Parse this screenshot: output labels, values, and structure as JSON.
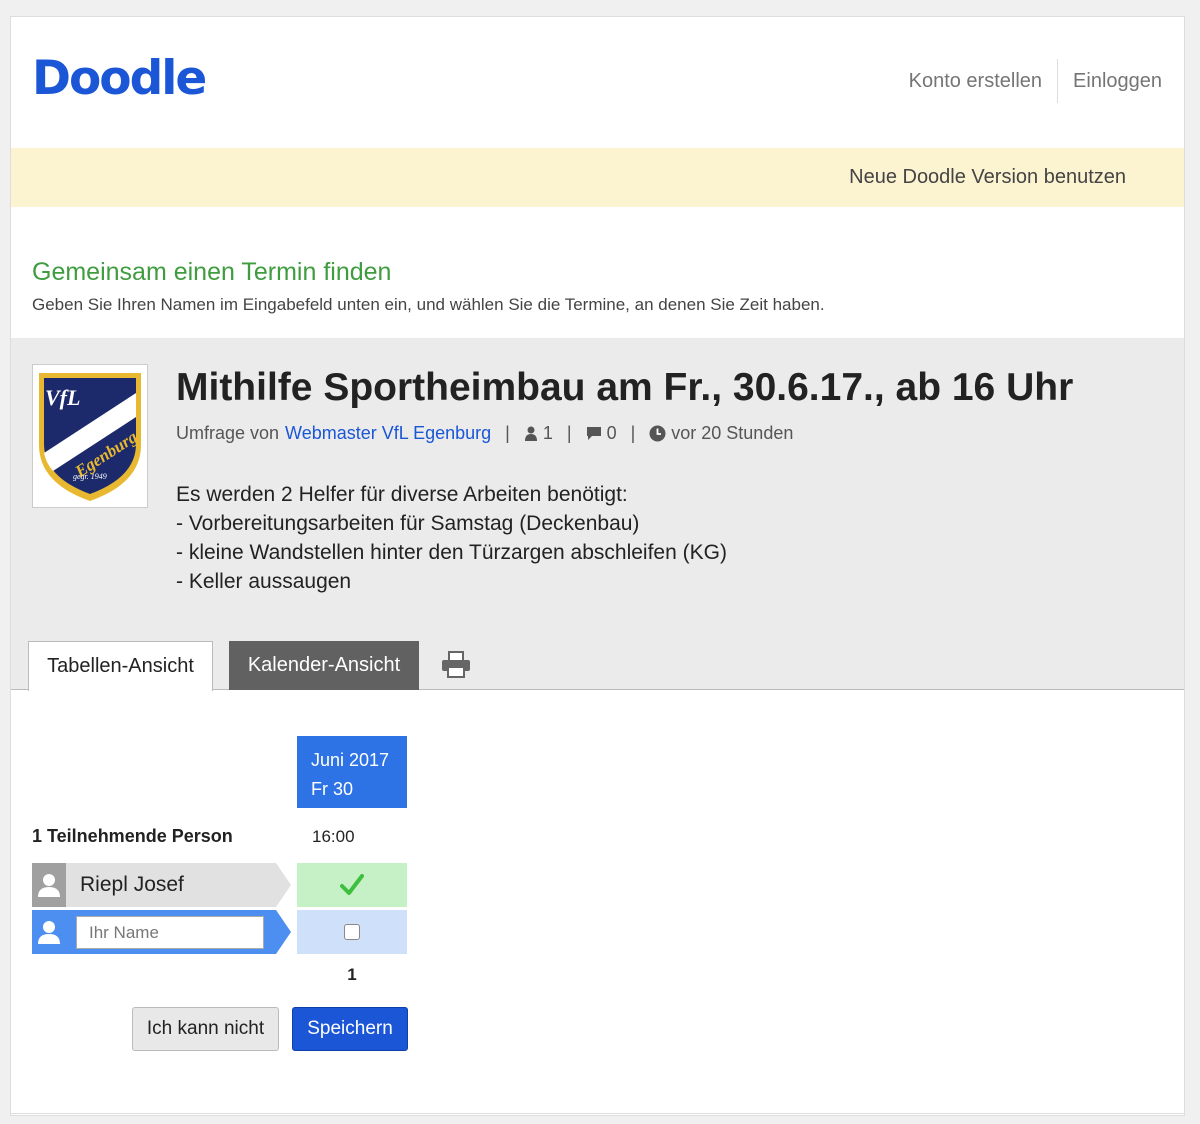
{
  "header": {
    "logo": "Doodle",
    "nav": {
      "signup": "Konto erstellen",
      "login": "Einloggen"
    }
  },
  "banner": {
    "link": "Neue Doodle Version benutzen"
  },
  "intro": {
    "title": "Gemeinsam einen Termin finden",
    "subtitle": "Geben Sie Ihren Namen im Eingabefeld unten ein, und wählen Sie die Termine, an denen Sie Zeit haben."
  },
  "poll": {
    "title": "Mithilfe Sportheimbau am Fr., 30.6.17., ab 16 Uhr",
    "author_prefix": "Umfrage von",
    "author": "Webmaster VfL Egenburg",
    "participants_count": "1",
    "comments_count": "0",
    "created": "vor 20 Stunden",
    "description": [
      "Es werden 2 Helfer für diverse Arbeiten benötigt:",
      "- Vorbereitungsarbeiten für Samstag (Deckenbau)",
      "- kleine Wandstellen hinter den Türzargen abschleifen (KG)",
      "- Keller aussaugen"
    ],
    "logo_text": {
      "line1": "VfL",
      "line2": "Egenburg",
      "line3": "gegr. 1949"
    }
  },
  "tabs": {
    "table": "Tabellen-Ansicht",
    "calendar": "Kalender-Ansicht"
  },
  "grid": {
    "month": "Juni 2017",
    "day": "Fr 30",
    "time": "16:00",
    "participants_label": "1 Teilnehmende Person",
    "rows": [
      {
        "name": "Riepl Josef",
        "vote": "yes"
      }
    ],
    "name_placeholder": "Ihr Name",
    "total": "1"
  },
  "buttons": {
    "cant": "Ich kann nicht",
    "save": "Speichern"
  },
  "colors": {
    "brand": "#1a56d6",
    "intro_green": "#3f9c3f",
    "yes_cell": "#c6f1c6",
    "date_head": "#2e73e6"
  }
}
